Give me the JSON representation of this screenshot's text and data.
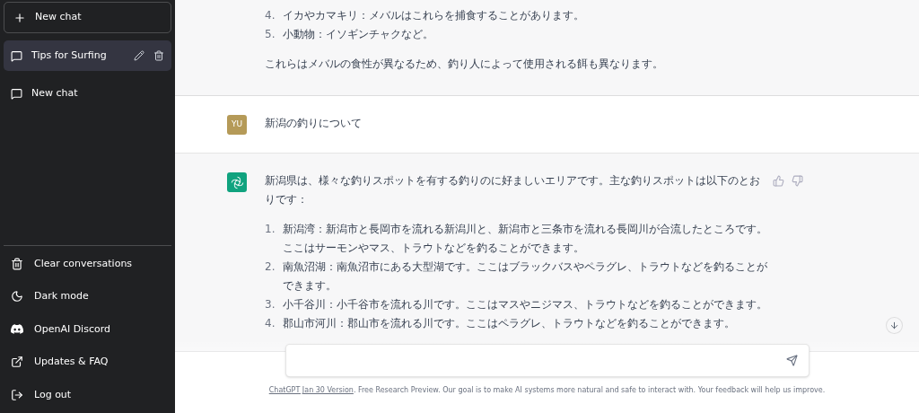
{
  "sidebar": {
    "new_chat": {
      "label": "New chat"
    },
    "conversations": [
      {
        "title": "Tips for Surfing",
        "selected": true
      },
      {
        "title": "New chat",
        "selected": false
      }
    ],
    "menu": [
      {
        "kind": "clear",
        "label": "Clear conversations"
      },
      {
        "kind": "theme",
        "label": "Dark mode"
      },
      {
        "kind": "discord",
        "label": "OpenAI Discord"
      },
      {
        "kind": "link",
        "label": "Updates & FAQ"
      },
      {
        "kind": "logout",
        "label": "Log out"
      }
    ]
  },
  "messages": [
    {
      "kind": "assistant",
      "partial": true,
      "blocks": [
        {
          "kind": "list",
          "items": [
            {
              "number": "4.",
              "text": "イカやカマキリ：メバルはこれらを捕食することがあります。"
            },
            {
              "number": "5.",
              "text": "小動物：イソギンチャクなど。"
            }
          ]
        },
        {
          "kind": "paragraph",
          "text": "これらはメバルの食性が異なるため、釣り人によって使用される餌も異なります。"
        }
      ]
    },
    {
      "kind": "user",
      "avatar": "YU",
      "blocks": [
        {
          "kind": "paragraph",
          "text": "新潟の釣りについて"
        }
      ]
    },
    {
      "kind": "assistant",
      "partial": false,
      "blocks": [
        {
          "kind": "paragraph",
          "text": "新潟県は、様々な釣りスポットを有する釣りのに好ましいエリアです。主な釣りスポットは以下のとおりです："
        },
        {
          "kind": "list",
          "items": [
            {
              "number": "1.",
              "text": "新潟湾：新潟市と長岡市を流れる新潟川と、新潟市と三条市を流れる長岡川が合流したところです。ここはサーモンやマス、トラウトなどを釣ることができます。"
            },
            {
              "number": "2.",
              "text": "南魚沼湖：南魚沼市にある大型湖です。ここはブラックバスやペラグレ、トラウトなどを釣ることができます。"
            },
            {
              "number": "3.",
              "text": "小千谷川：小千谷市を流れる川です。ここはマスやニジマス、トラウトなどを釣ることができます。"
            },
            {
              "number": "4.",
              "text": "郡山市河川：郡山市を流れる川です。ここはペラグレ、トラウトなどを釣ることができます。"
            }
          ]
        }
      ]
    }
  ],
  "composer": {
    "footer_link": "ChatGPT Jan 30 Version",
    "footer_text": ". Free Research Preview. Our goal is to make AI systems more natural and safe to interact with. Your feedback will help us improve."
  }
}
